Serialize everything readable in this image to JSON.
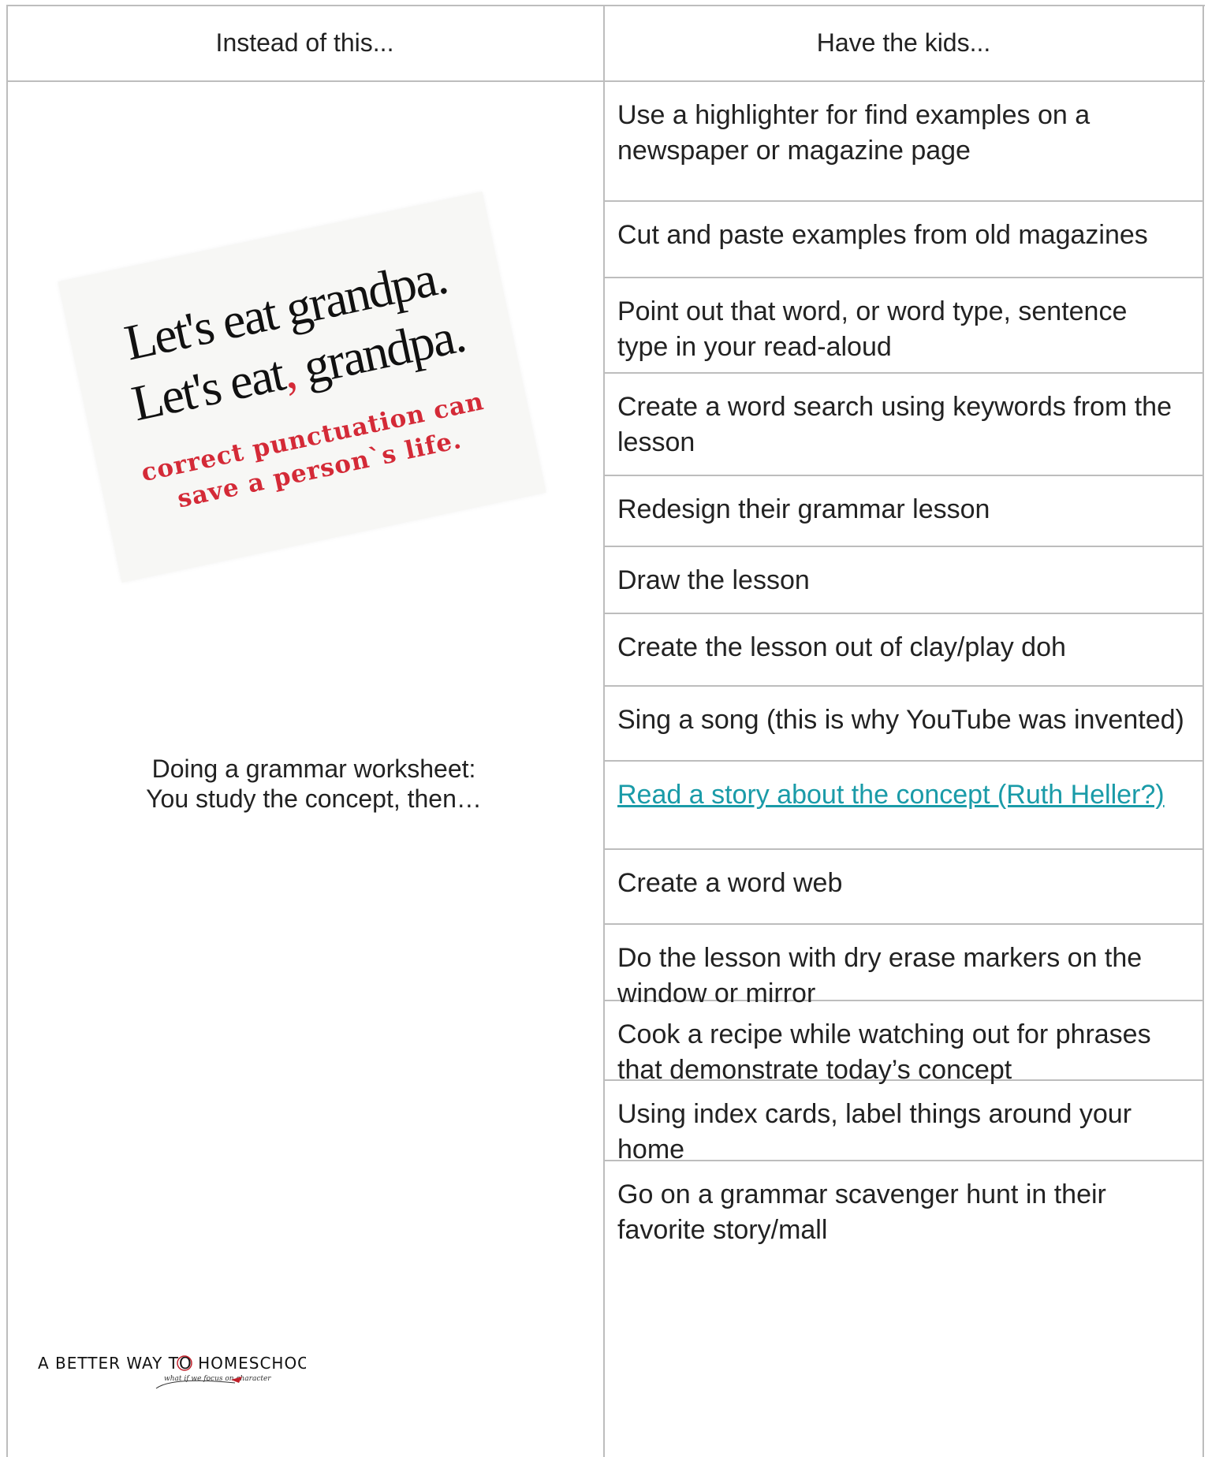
{
  "headers": {
    "left": "Instead of this...",
    "right": "Have the kids..."
  },
  "left": {
    "image_caption": {
      "line1": "Let's eat grandpa.",
      "line2_part1": "Let's eat",
      "line2_comma": ",",
      "line2_part2": " grandpa.",
      "sub1": "correct punctuation can",
      "sub2": "save a person`s life."
    },
    "description_line1": "Doing a grammar worksheet:",
    "description_line2": "You study the concept, then…",
    "logo": {
      "text": "A BETTER WAY TO HOMESCHOOL",
      "tagline": "what if we focus on character"
    }
  },
  "rows": [
    "Use a highlighter for find examples on a newspaper or magazine page",
    "Cut and paste examples from old magazines",
    "Point out that word, or word type, sentence type in your read-aloud",
    "Create a word search using keywords from the lesson",
    "Redesign their grammar lesson",
    "Draw the lesson",
    "Create the lesson out of clay/play doh",
    "Sing a song (this is why YouTube was invented)",
    "Read a story about the concept (Ruth Heller?)",
    "Create a word web",
    "Do the lesson with dry erase markers on the window or mirror",
    "Cook a recipe while watching out for phrases that demonstrate today’s concept",
    "Using index cards, label things around your home",
    "Go on a grammar scavenger hunt in their favorite story/mall"
  ],
  "link_row_index": 8,
  "colors": {
    "border": "#bdbdbd",
    "link": "#1a9ba8",
    "accent_red": "#d42a37"
  }
}
